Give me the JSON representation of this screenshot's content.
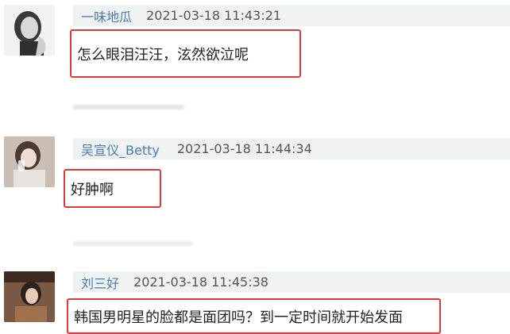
{
  "comments": [
    {
      "username": "一味地瓜",
      "time": "2021-03-18 11:43:21",
      "text": "怎么眼泪汪汪，泫然欲泣呢",
      "avatar": "portrait-woman-bw-avatar"
    },
    {
      "username": "吴宣仪_Betty",
      "time": "2021-03-18 11:44:34",
      "text": "好肿啊",
      "avatar": "portrait-woman-cup-avatar"
    },
    {
      "username": "刘三好",
      "time": "2021-03-18 11:45:38",
      "text": "韩国男明星的脸都是面团吗？到一定时间就开始发面",
      "avatar": "costume-drama-avatar"
    }
  ]
}
